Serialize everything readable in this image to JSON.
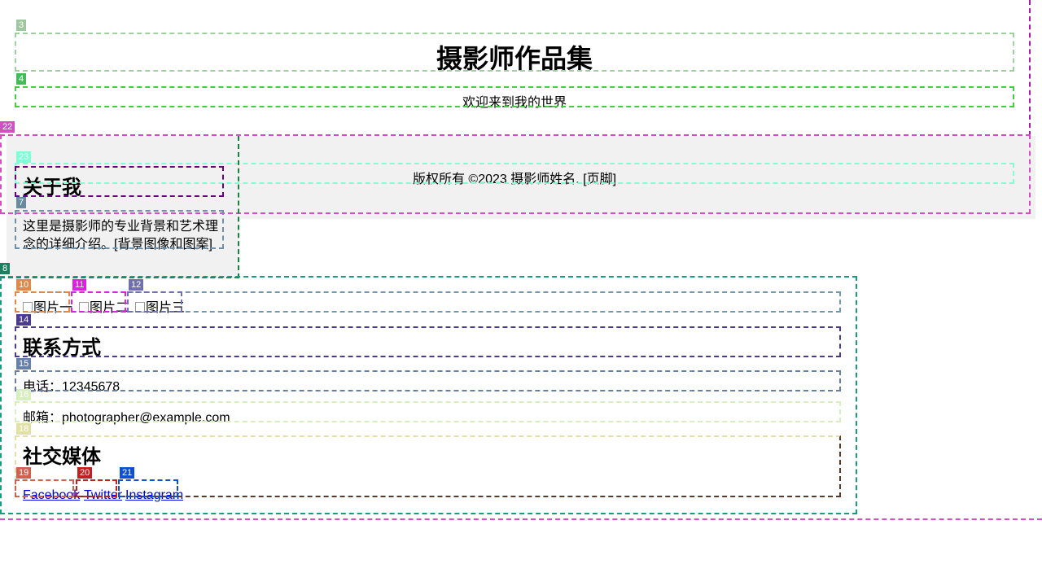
{
  "header": {
    "title": "摄影师作品集",
    "subtitle": "欢迎来到我的世界"
  },
  "about": {
    "title": "关于我",
    "text": "这里是摄影师的专业背景和艺术理念的详细介绍。[背景图像和图案]"
  },
  "gallery": {
    "images": [
      {
        "alt": "图片一"
      },
      {
        "alt": "图片二"
      },
      {
        "alt": "图片三"
      }
    ]
  },
  "contact": {
    "title": "联系方式",
    "phone": "电话：12345678",
    "email": "邮箱：photographer@example.com"
  },
  "social": {
    "title": "社交媒体",
    "links": [
      "Facebook",
      "Twitter",
      "Instagram"
    ]
  },
  "footer": {
    "text": "版权所有 ©2023 摄影师姓名. [页脚]"
  },
  "overlay_labels": [
    "3",
    "4",
    "22",
    "23",
    "7",
    "8",
    "10",
    "11",
    "12",
    "14",
    "15",
    "16",
    "18",
    "19",
    "20",
    "21"
  ],
  "colors": {
    "link": "#0000ee",
    "panel_bg": "#f1f1f1"
  }
}
